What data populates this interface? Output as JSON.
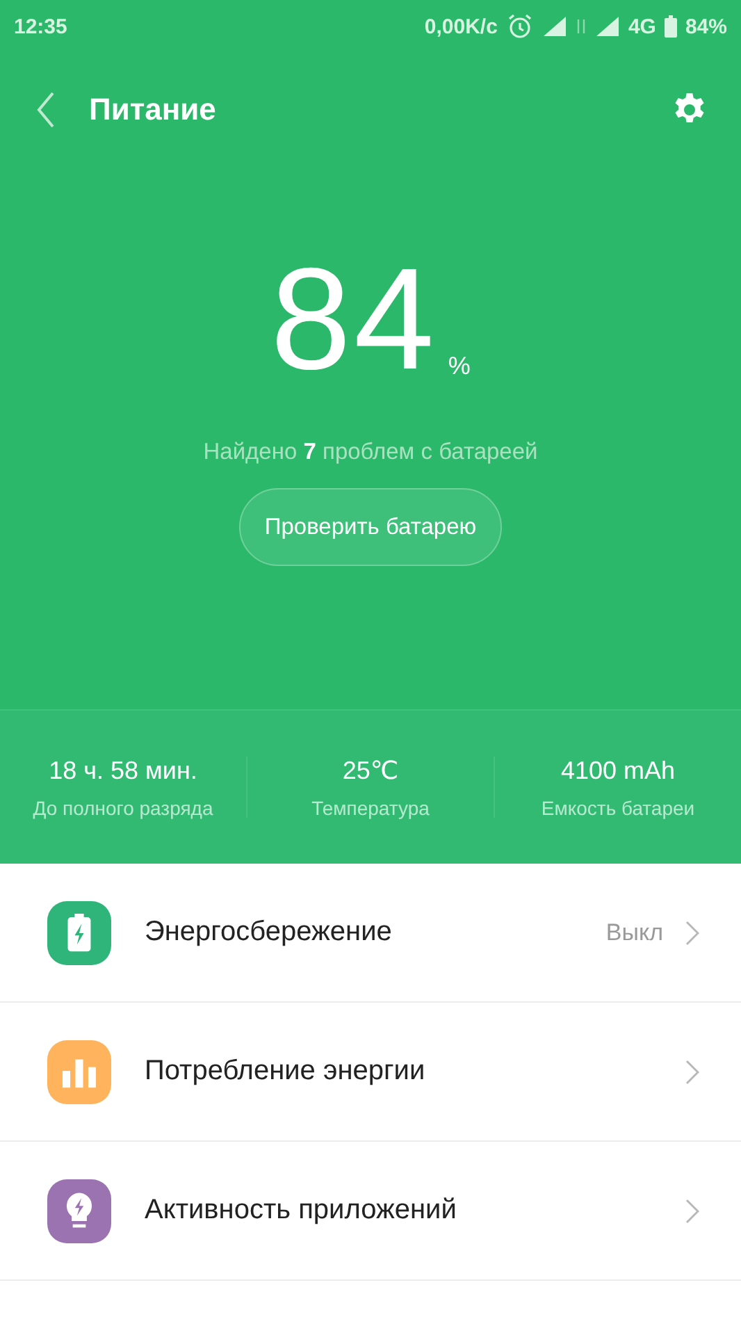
{
  "status_bar": {
    "time": "12:35",
    "speed": "0,00K/с",
    "network": "4G",
    "battery": "84%"
  },
  "header": {
    "title": "Питание"
  },
  "battery": {
    "value": "84",
    "unit": "%",
    "issues": "Найдено **7** проблем с батареей",
    "button": "Проверить батарею"
  },
  "stats": [
    {
      "value": "18 ч. 58 мин.",
      "label": "До полного разряда"
    },
    {
      "value": "25℃",
      "label": "Температура"
    },
    {
      "value": "4100 mAh",
      "label": "Емкость батареи"
    }
  ],
  "items": [
    {
      "kind": "battery",
      "color": "#2fb57a",
      "title": "Энергосбережение",
      "value": "Выкл"
    },
    {
      "kind": "chart",
      "color": "#ffb35c",
      "title": "Потребление энергии"
    },
    {
      "kind": "bulb",
      "color": "#9b73b0",
      "title": "Активность приложений"
    }
  ]
}
